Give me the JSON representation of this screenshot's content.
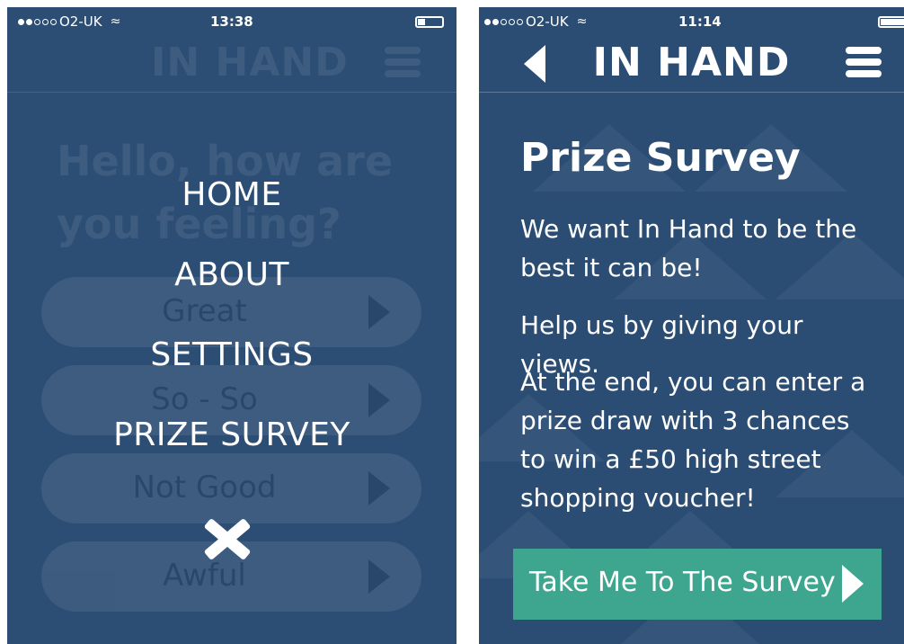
{
  "left_screen": {
    "status": {
      "carrier": "O2-UK",
      "time": "13:38"
    },
    "background": {
      "app_title": "IN HAND",
      "greeting": "Hello, how are you feeling?",
      "moods": [
        "Great",
        "So - So",
        "Not Good",
        "Awful"
      ]
    },
    "menu": {
      "items": [
        "HOME",
        "ABOUT",
        "SETTINGS",
        "PRIZE SURVEY"
      ]
    }
  },
  "right_screen": {
    "status": {
      "carrier": "O2-UK",
      "time": "11:14"
    },
    "app_title": "IN HAND",
    "page_title": "Prize Survey",
    "paragraphs": [
      "We want In Hand to be the best it can be!",
      "Help us by giving your views.",
      "At the end, you can enter a prize draw with 3 chances to win a £50 high street shopping voucher!"
    ],
    "cta_label": "Take Me To The Survey"
  },
  "colors": {
    "background": "#2c4e74",
    "button": "#3ea68f",
    "text": "#ffffff"
  }
}
